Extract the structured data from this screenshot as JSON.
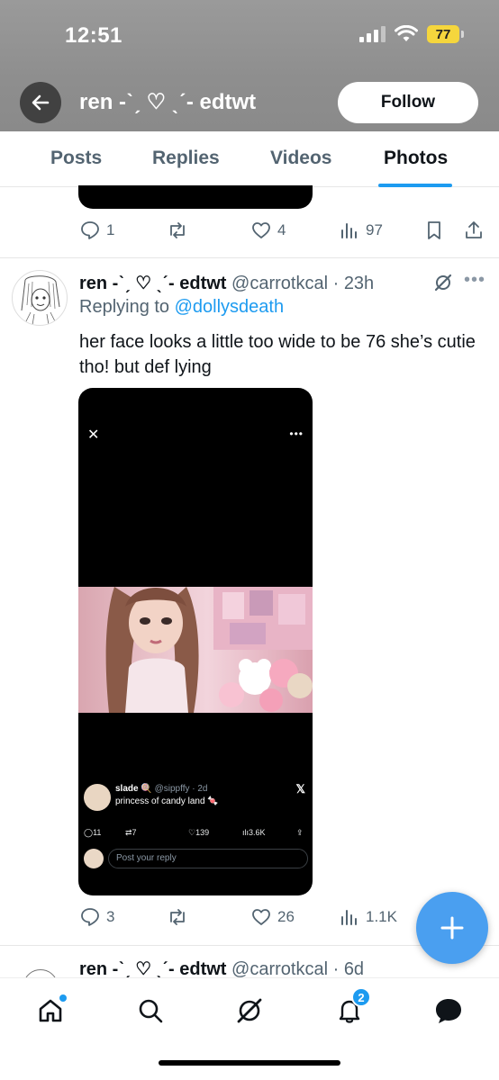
{
  "status_bar": {
    "time": "12:51",
    "battery": "77"
  },
  "header": {
    "title": "ren -ˋˏ ♡ ˎˊ- edtwt",
    "follow_label": "Follow"
  },
  "tabs": [
    {
      "label": "Posts",
      "active": false
    },
    {
      "label": "Replies",
      "active": false
    },
    {
      "label": "Videos",
      "active": false
    },
    {
      "label": "Photos",
      "active": true
    }
  ],
  "prev_tweet": {
    "replies": "1",
    "likes": "4",
    "views": "97"
  },
  "tweet": {
    "name": "ren -ˋˏ ♡ ˎˊ- edtwt",
    "handle": "@carrotkcal",
    "time": "23h",
    "replying_prefix": "Replying to",
    "replying_to": "@dollysdeath",
    "text": "her face looks a little too wide to be 76 she’s cutie tho! but def lying",
    "replies": "3",
    "likes": "26",
    "views": "1.1K",
    "embed": {
      "name": "slade",
      "handle": "@sippffy",
      "time": "2d",
      "text": "princess of candy land",
      "replies": "11",
      "reposts": "7",
      "likes": "139",
      "views": "3.6K",
      "reply_placeholder": "Post your reply"
    }
  },
  "next_tweet": {
    "name": "ren -ˋˏ ♡ ˎˊ- edtwt",
    "handle": "@carrotkcal",
    "time": "6d"
  },
  "bottom_nav": {
    "notification_count": "2"
  },
  "colors": {
    "accent": "#1d9bf0",
    "muted": "#536471",
    "battery": "#f5d63d"
  }
}
